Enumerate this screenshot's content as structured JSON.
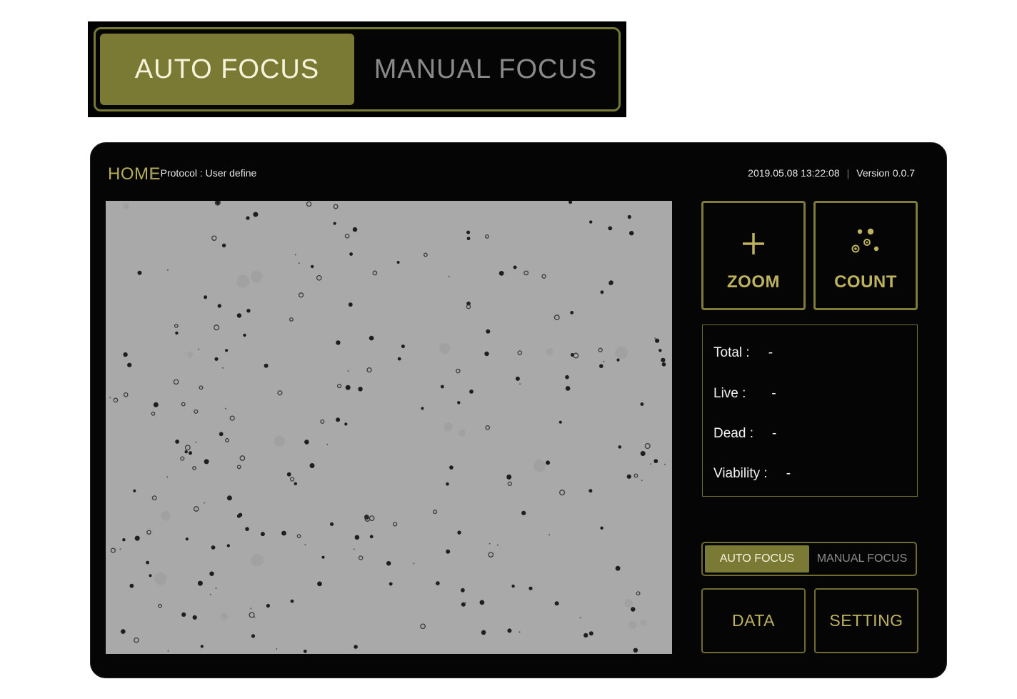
{
  "focus_toggle": {
    "auto_label": "AUTO FOCUS",
    "manual_label": "MANUAL FOCUS",
    "selected": "AUTO FOCUS"
  },
  "header": {
    "title": "HOME",
    "protocol_label": "Protocol : User define",
    "datetime": "2019.05.08 13:22:08",
    "version": "Version 0.0.7"
  },
  "actions": {
    "zoom_label": "ZOOM",
    "zoom_icon": "plus-icon",
    "count_label": "COUNT",
    "count_icon": "cells-dots-icon"
  },
  "stats": [
    {
      "label": "Total :",
      "value": "-"
    },
    {
      "label": "Live :",
      "value": "-"
    },
    {
      "label": "Dead :",
      "value": "-"
    },
    {
      "label": "Viability :",
      "value": "-"
    }
  ],
  "bottom_buttons": {
    "data_label": "DATA",
    "setting_label": "SETTING"
  },
  "colors": {
    "accent": "#bdb25e",
    "active_fill": "#7b7a35",
    "panel_bg": "#050505",
    "image_bg": "#a9a9a9"
  }
}
